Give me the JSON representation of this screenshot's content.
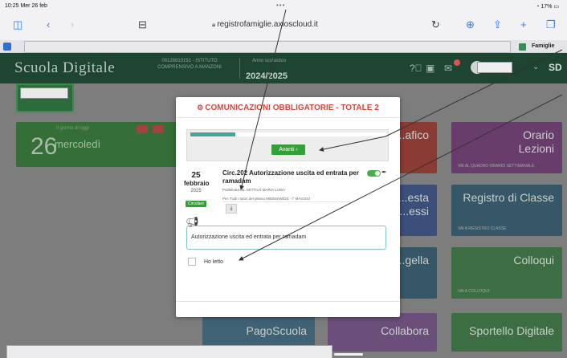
{
  "status_bar": {
    "time": "10:25  Mer 26 feb",
    "battery": "17%"
  },
  "browser": {
    "url": "registrofamiglie.axioscloud.it",
    "tab_label": "Famiglie"
  },
  "app": {
    "logo": "Scuola Digitale",
    "school_info": "00126810151 - ISTITUTO COMPRENSIVO A.MANZONI",
    "year_label": "Anno scolastico",
    "year_value": "2024/2025",
    "user_initials": "SD"
  },
  "date_card": {
    "day_number": "26",
    "day_name": "mercoledì",
    "caption": "Il giorno di oggi"
  },
  "tiles": [
    {
      "title": "...afico",
      "foot": ""
    },
    {
      "title": "Orario\nLezioni",
      "foot": "VAI AL QUADRO ORARIO SETTIMANALE"
    },
    {
      "title": "...esta\n...essi",
      "foot": ""
    },
    {
      "title": "Registro di Classe",
      "foot": "VAI A REGISTRO CLASSE"
    },
    {
      "title": "...gella",
      "foot": ""
    },
    {
      "title": "Colloqui",
      "foot": "VAI A COLLOQUI"
    },
    {
      "title": "PagoScuola",
      "foot": ""
    },
    {
      "title": "Collabora",
      "foot": ""
    },
    {
      "title": "Sportello Digitale",
      "foot": ""
    }
  ],
  "modal": {
    "title": "COMUNICAZIONI OBBLIGATORIE - TOTALE 2",
    "progress_fraction": 0.23,
    "next_button": "Avanti",
    "date_day": "25",
    "date_month": "febbraio",
    "date_year": "2025",
    "date_badge": "Circolare",
    "circular_title": "Circ.202 Autorizzazione uscita ed entrata per ramadam",
    "published_by": "Pubblicata da: SETTILO MARIA LUISA",
    "recipients": "Per: Tutti i tutori del plesso MIEE8AW024 - I° MAGGIO",
    "toggle_label": "Sì",
    "message_text": "Autorizzazione uscita ed entrata per ramadam",
    "read_label": "Ho letto"
  },
  "colors": {
    "header_bg": "#1e4432",
    "modal_title": "#d9453b",
    "accent_green": "#35a035",
    "progress_teal": "#46a59a"
  },
  "icons": [
    "sidebar-icon",
    "back-icon",
    "forward-icon",
    "reader-icon",
    "lock-icon",
    "reload-icon",
    "download-icon",
    "share-icon",
    "new-tab-icon",
    "tabs-icon",
    "help-icon",
    "id-card-icon",
    "messages-icon",
    "chevron-down-icon",
    "megaphone-icon",
    "pin-icon",
    "download-attachment-icon"
  ]
}
